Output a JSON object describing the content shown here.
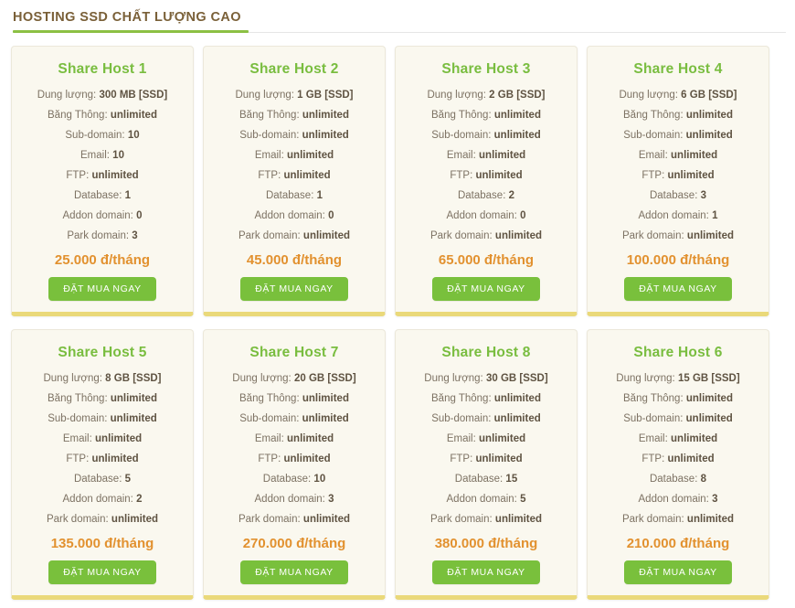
{
  "section": {
    "title": "HOSTING SSD CHẤT LƯỢNG CAO",
    "accent_color": "#8cc044",
    "title_color": "#7a6038"
  },
  "labels": {
    "storage": "Dung lượng:",
    "bandwidth": "Băng Thông:",
    "subdomain": "Sub-domain:",
    "email": "Email:",
    "ftp": "FTP:",
    "database": "Database:",
    "addon_domain": "Addon domain:",
    "park_domain": "Park domain:"
  },
  "theme": {
    "card_background": "#faf8ef",
    "card_bottom_bar": "#ead97a",
    "title_green": "#79bd3f",
    "price_orange": "#e2912f",
    "button_green": "#79c03c"
  },
  "plans": [
    {
      "name": "Share Host 1",
      "storage": "300 MB [SSD]",
      "bandwidth": "unlimited",
      "subdomain": "10",
      "email": "10",
      "ftp": "unlimited",
      "database": "1",
      "addon_domain": "0",
      "park_domain": "3",
      "price": "25.000 đ/tháng",
      "cta": "ĐẶT MUA NGAY"
    },
    {
      "name": "Share Host 2",
      "storage": "1 GB [SSD]",
      "bandwidth": "unlimited",
      "subdomain": "unlimited",
      "email": "unlimited",
      "ftp": "unlimited",
      "database": "1",
      "addon_domain": "0",
      "park_domain": "unlimited",
      "price": "45.000 đ/tháng",
      "cta": "ĐẶT MUA NGAY"
    },
    {
      "name": "Share Host 3",
      "storage": "2 GB [SSD]",
      "bandwidth": "unlimited",
      "subdomain": "unlimited",
      "email": "unlimited",
      "ftp": "unlimited",
      "database": "2",
      "addon_domain": "0",
      "park_domain": "unlimited",
      "price": "65.000 đ/tháng",
      "cta": "ĐẶT MUA NGAY"
    },
    {
      "name": "Share Host 4",
      "storage": "6 GB [SSD]",
      "bandwidth": "unlimited",
      "subdomain": "unlimited",
      "email": "unlimited",
      "ftp": "unlimited",
      "database": "3",
      "addon_domain": "1",
      "park_domain": "unlimited",
      "price": "100.000 đ/tháng",
      "cta": "ĐẶT MUA NGAY"
    },
    {
      "name": "Share Host 5",
      "storage": "8 GB [SSD]",
      "bandwidth": "unlimited",
      "subdomain": "unlimited",
      "email": "unlimited",
      "ftp": "unlimited",
      "database": "5",
      "addon_domain": "2",
      "park_domain": "unlimited",
      "price": "135.000 đ/tháng",
      "cta": "ĐẶT MUA NGAY"
    },
    {
      "name": "Share Host 7",
      "storage": "20 GB [SSD]",
      "bandwidth": "unlimited",
      "subdomain": "unlimited",
      "email": "unlimited",
      "ftp": "unlimited",
      "database": "10",
      "addon_domain": "3",
      "park_domain": "unlimited",
      "price": "270.000 đ/tháng",
      "cta": "ĐẶT MUA NGAY"
    },
    {
      "name": "Share Host 8",
      "storage": "30 GB [SSD]",
      "bandwidth": "unlimited",
      "subdomain": "unlimited",
      "email": "unlimited",
      "ftp": "unlimited",
      "database": "15",
      "addon_domain": "5",
      "park_domain": "unlimited",
      "price": "380.000 đ/tháng",
      "cta": "ĐẶT MUA NGAY"
    },
    {
      "name": "Share Host 6",
      "storage": "15 GB [SSD]",
      "bandwidth": "unlimited",
      "subdomain": "unlimited",
      "email": "unlimited",
      "ftp": "unlimited",
      "database": "8",
      "addon_domain": "3",
      "park_domain": "unlimited",
      "price": "210.000 đ/tháng",
      "cta": "ĐẶT MUA NGAY"
    }
  ]
}
